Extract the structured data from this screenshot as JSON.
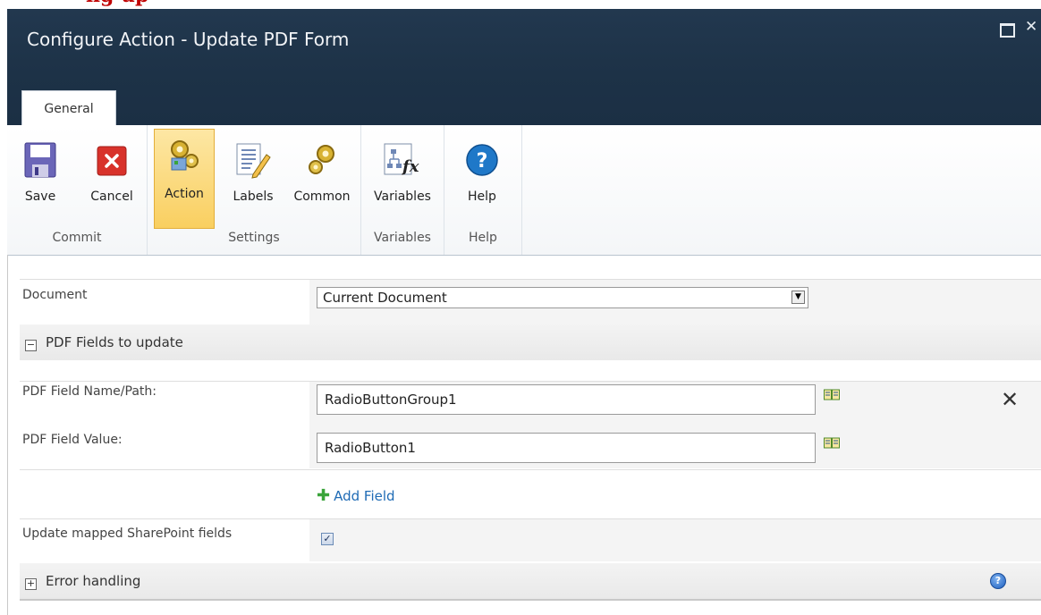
{
  "page_heading_fragment": "ng up",
  "dialog": {
    "title": "Configure Action - Update PDF Form",
    "tab": "General"
  },
  "ribbon": {
    "groups": {
      "commit": "Commit",
      "settings": "Settings",
      "variables": "Variables",
      "help": "Help"
    },
    "buttons": {
      "save": "Save",
      "cancel": "Cancel",
      "action": "Action",
      "labels": "Labels",
      "common": "Common",
      "variables": "Variables",
      "help": "Help"
    }
  },
  "form": {
    "document_label": "Document",
    "document_value": "Current Document",
    "pdf_section_title": "PDF Fields to update",
    "pdf_section_toggle": "−",
    "field_name_label": "PDF Field Name/Path:",
    "field_name_value": "RadioButtonGroup1",
    "field_value_label": "PDF Field Value:",
    "field_value_value": "RadioButton1",
    "add_field": "Add Field",
    "update_mapped_label": "Update mapped SharePoint fields",
    "update_mapped_checked": true,
    "error_section_title": "Error handling",
    "error_section_toggle": "+"
  },
  "icons": {
    "save": "floppy-disk-icon",
    "cancel": "red-x-icon",
    "action": "gears-icon",
    "labels": "notepad-pencil-icon",
    "common": "gears-icon",
    "variables": "fx-diagram-icon",
    "help": "question-circle-icon"
  },
  "colors": {
    "header_bg": "#1d3247",
    "active_button": "#f9cf60",
    "link": "#1f6bb5",
    "heading_red": "#c00000"
  }
}
